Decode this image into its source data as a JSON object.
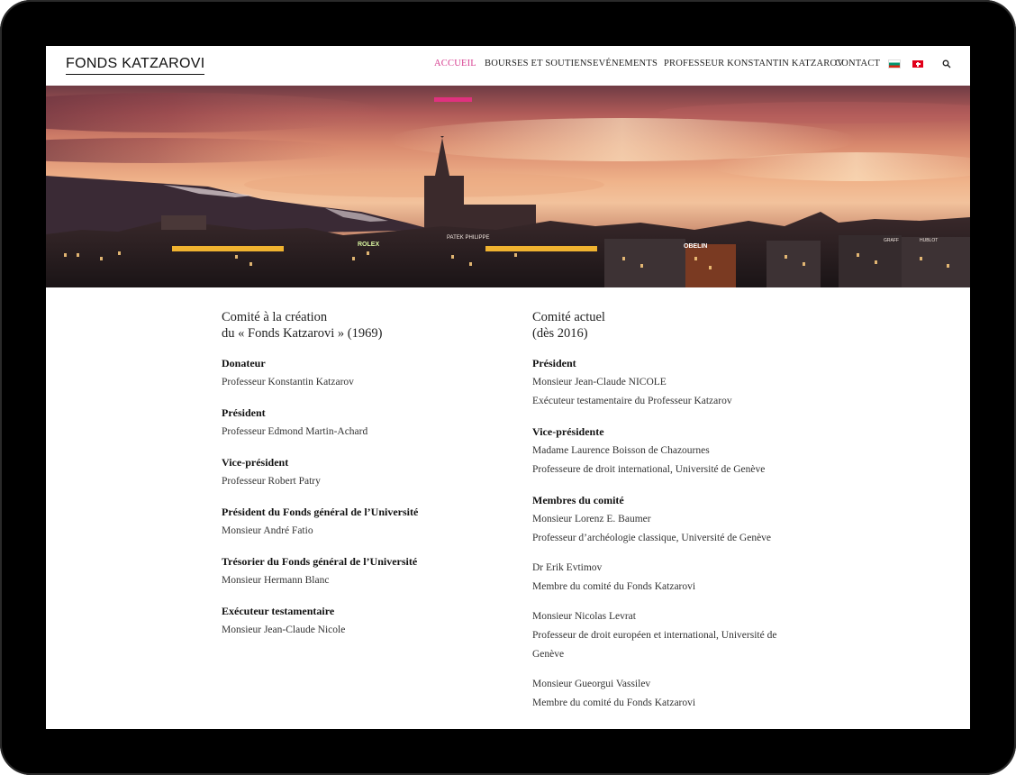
{
  "header": {
    "logo": "FONDS KATZAROVI",
    "nav": [
      {
        "label": "ACCUEIL",
        "active": true
      },
      {
        "label": "BOURSES ET SOUTIENS",
        "active": false
      },
      {
        "label": "EVÉNEMENTS",
        "active": false
      },
      {
        "label": "PROFESSEUR KONSTANTIN KATZAROV",
        "active": false
      },
      {
        "label": "CONTACT",
        "active": false
      }
    ],
    "flags": [
      "bulgaria-flag-icon",
      "switzerland-flag-icon"
    ],
    "search_icon": "search-icon",
    "accent_color": "#e0317f"
  },
  "hero": {
    "signs": [
      "ROLEX",
      "PATEK PHILIPPE",
      "OBELIN",
      "GRAFF",
      "HUBLOT"
    ]
  },
  "left": {
    "heading_line1": "Comité à la création",
    "heading_line2": "du « Fonds Katzarovi » (1969)",
    "groups": [
      {
        "role": "Donateur",
        "lines": [
          "Professeur Konstantin Katzarov"
        ]
      },
      {
        "role": "Président",
        "lines": [
          "Professeur Edmond Martin-Achard"
        ]
      },
      {
        "role": "Vice-président",
        "lines": [
          "Professeur Robert Patry"
        ]
      },
      {
        "role": "Président du Fonds général de l’Université",
        "lines": [
          "Monsieur André Fatio"
        ]
      },
      {
        "role": "Trésorier du Fonds général de l’Université",
        "lines": [
          "Monsieur Hermann Blanc"
        ]
      },
      {
        "role": "Exécuteur testamentaire",
        "lines": [
          "Monsieur Jean-Claude Nicole"
        ]
      }
    ]
  },
  "right": {
    "heading_line1": "Comité actuel",
    "heading_line2": "(dès 2016)",
    "president_role": "Président",
    "president_lines": [
      "Monsieur Jean-Claude NICOLE",
      "Exécuteur testamentaire du Professeur Katzarov"
    ],
    "vp_role": "Vice-présidente",
    "vp_lines": [
      "Madame Laurence Boisson de Chazournes",
      "Professeure de droit international, Université de Genève"
    ],
    "members_role": "Membres du comité",
    "members": [
      {
        "name": "Monsieur Lorenz E. Baumer",
        "desc": "Professeur d’archéologie classique, Université de Genève"
      },
      {
        "name": "Dr Erik Evtimov",
        "desc": "Membre du comité du Fonds Katzarovi"
      },
      {
        "name": "Monsieur Nicolas Levrat",
        "desc": "Professeur de droit européen et international, Université de Genève"
      },
      {
        "name": "Monsieur Gueorgui Vassilev",
        "desc": "Membre du comité du Fonds Katzarovi"
      }
    ]
  }
}
